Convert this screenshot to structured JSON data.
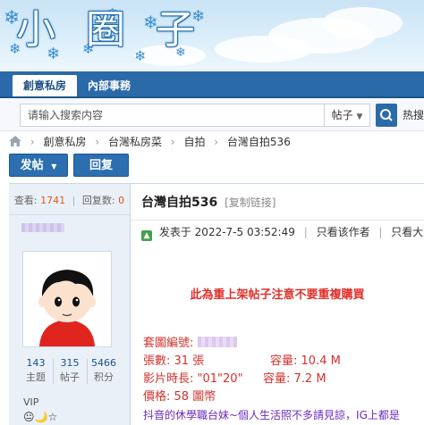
{
  "banner": {
    "logo_chars": [
      "小",
      "圈",
      "子"
    ]
  },
  "nav": {
    "tabs": [
      {
        "label": "創意私房",
        "active": true
      },
      {
        "label": "內部事務",
        "active": false
      }
    ]
  },
  "search": {
    "placeholder": "请输入搜索内容",
    "type_label": "帖子",
    "hot_label": "热搜"
  },
  "breadcrumb": {
    "items": [
      "創意私房",
      "台灣私房菜",
      "自拍",
      "台灣自拍536"
    ]
  },
  "actions": {
    "post_label": "发帖",
    "reply_label": "回复"
  },
  "thread": {
    "view_label": "查看:",
    "views": "1741",
    "reply_label": "回复数:",
    "replies": "0",
    "title": "台灣自拍536",
    "copy_link": "[复制链接]"
  },
  "author": {
    "stats": [
      {
        "value": "143",
        "label": "主题"
      },
      {
        "value": "315",
        "label": "帖子"
      },
      {
        "value": "5466",
        "label": "积分"
      }
    ],
    "group": "VIP",
    "medals": "😐🌙☆"
  },
  "post": {
    "published_label": "发表于",
    "published_at": "2022-7-5 03:52:49",
    "only_author": "只看该作者",
    "big_image": "只看大图",
    "notice": "此為重上架帖子注意不要重複購買",
    "album_id_label": "套圖編號:",
    "sheets_label": "張數:",
    "sheets_value": "31 張",
    "capacity_label": "容量:",
    "capacity_value": "10.4 M",
    "duration_label": "影片時長:",
    "duration_value": "\"01\"20\"",
    "capacity2_label": "容量:",
    "capacity2_value": "7.2 M",
    "price_label": "價格:",
    "price_value": "58 圖幣",
    "description": "抖音的休學職台妹~個人生活照不多請見諒，IG上都是"
  },
  "colors": {
    "nav_bg": "#2b6aa8",
    "accent": "#2c6eb0",
    "notice_red": "#e0302a",
    "highlight_orange": "#e0581b",
    "sidebar_bg": "#e9f0f8"
  }
}
